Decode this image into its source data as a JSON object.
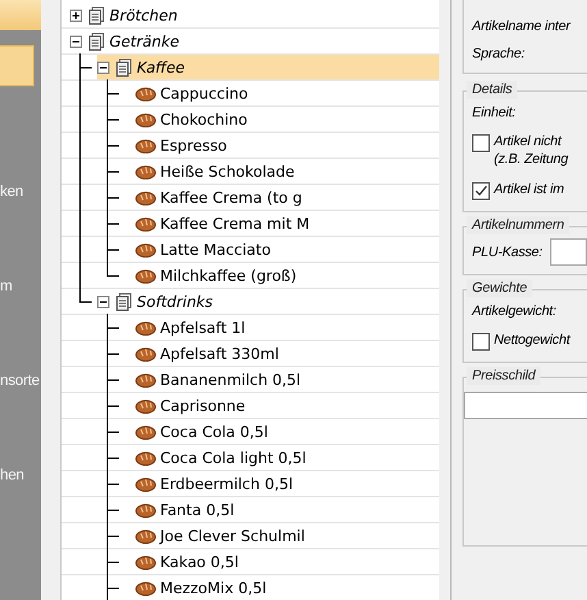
{
  "sidebar": {
    "items": [
      {
        "label": "ken"
      },
      {
        "label": "m"
      },
      {
        "label": "nsorte"
      },
      {
        "label": "hen"
      }
    ]
  },
  "tree": {
    "items": [
      {
        "label": "Brötchen",
        "kind": "folder",
        "expanded": false,
        "selected": false
      },
      {
        "label": "Getränke",
        "kind": "folder",
        "expanded": true,
        "selected": false,
        "children": [
          {
            "label": "Kaffee",
            "kind": "folder",
            "expanded": true,
            "selected": true,
            "children": [
              {
                "label": "Cappuccino",
                "kind": "article",
                "selected": false
              },
              {
                "label": "Chokochino",
                "kind": "article",
                "selected": false
              },
              {
                "label": "Espresso",
                "kind": "article",
                "selected": false
              },
              {
                "label": "Heiße Schokolade",
                "kind": "article",
                "selected": false
              },
              {
                "label": "Kaffee Crema (to g",
                "kind": "article",
                "selected": false
              },
              {
                "label": "Kaffee Crema mit M",
                "kind": "article",
                "selected": false
              },
              {
                "label": "Latte Macciato",
                "kind": "article",
                "selected": false
              },
              {
                "label": "Milchkaffee (groß)",
                "kind": "article",
                "selected": false
              }
            ]
          },
          {
            "label": "Softdrinks",
            "kind": "folder",
            "expanded": true,
            "selected": false,
            "continues": true,
            "children": [
              {
                "label": "Apfelsaft 1l",
                "kind": "article",
                "selected": false
              },
              {
                "label": "Apfelsaft 330ml",
                "kind": "article",
                "selected": false
              },
              {
                "label": "Bananenmilch 0,5l",
                "kind": "article",
                "selected": false
              },
              {
                "label": "Caprisonne",
                "kind": "article",
                "selected": false
              },
              {
                "label": "Coca Cola 0,5l",
                "kind": "article",
                "selected": false
              },
              {
                "label": "Coca Cola light 0,5l",
                "kind": "article",
                "selected": false
              },
              {
                "label": "Erdbeermilch 0,5l",
                "kind": "article",
                "selected": false
              },
              {
                "label": "Fanta 0,5l",
                "kind": "article",
                "selected": false
              },
              {
                "label": "Joe Clever Schulmil",
                "kind": "article",
                "selected": false
              },
              {
                "label": "Kakao 0,5l",
                "kind": "article",
                "selected": false
              },
              {
                "label": "MezzoMix 0,5l",
                "kind": "article",
                "selected": false
              }
            ]
          }
        ]
      }
    ]
  },
  "form": {
    "groups": [
      {
        "fields": [
          {
            "kind": "label",
            "label": "Artikelname inter"
          },
          {
            "kind": "label",
            "label": "Sprache:"
          }
        ]
      },
      {
        "title": "Details",
        "fields": [
          {
            "kind": "label",
            "label": "Einheit:"
          },
          {
            "kind": "checkbox",
            "label": "Artikel nicht",
            "note": "(z.B. Zeitung",
            "checked": false
          },
          {
            "kind": "checkbox",
            "label": "Artikel ist im",
            "checked": true
          }
        ]
      },
      {
        "title": "Artikelnummern",
        "fields": [
          {
            "kind": "input",
            "label": "PLU-Kasse:"
          }
        ]
      },
      {
        "title": "Gewichte",
        "fields": [
          {
            "kind": "label",
            "label": "Artikelgewicht:"
          },
          {
            "kind": "checkbox",
            "label": "Nettogewicht",
            "checked": false
          }
        ]
      },
      {
        "title": "Preisschild",
        "fields": [
          {
            "kind": "wideinput"
          }
        ]
      }
    ]
  }
}
